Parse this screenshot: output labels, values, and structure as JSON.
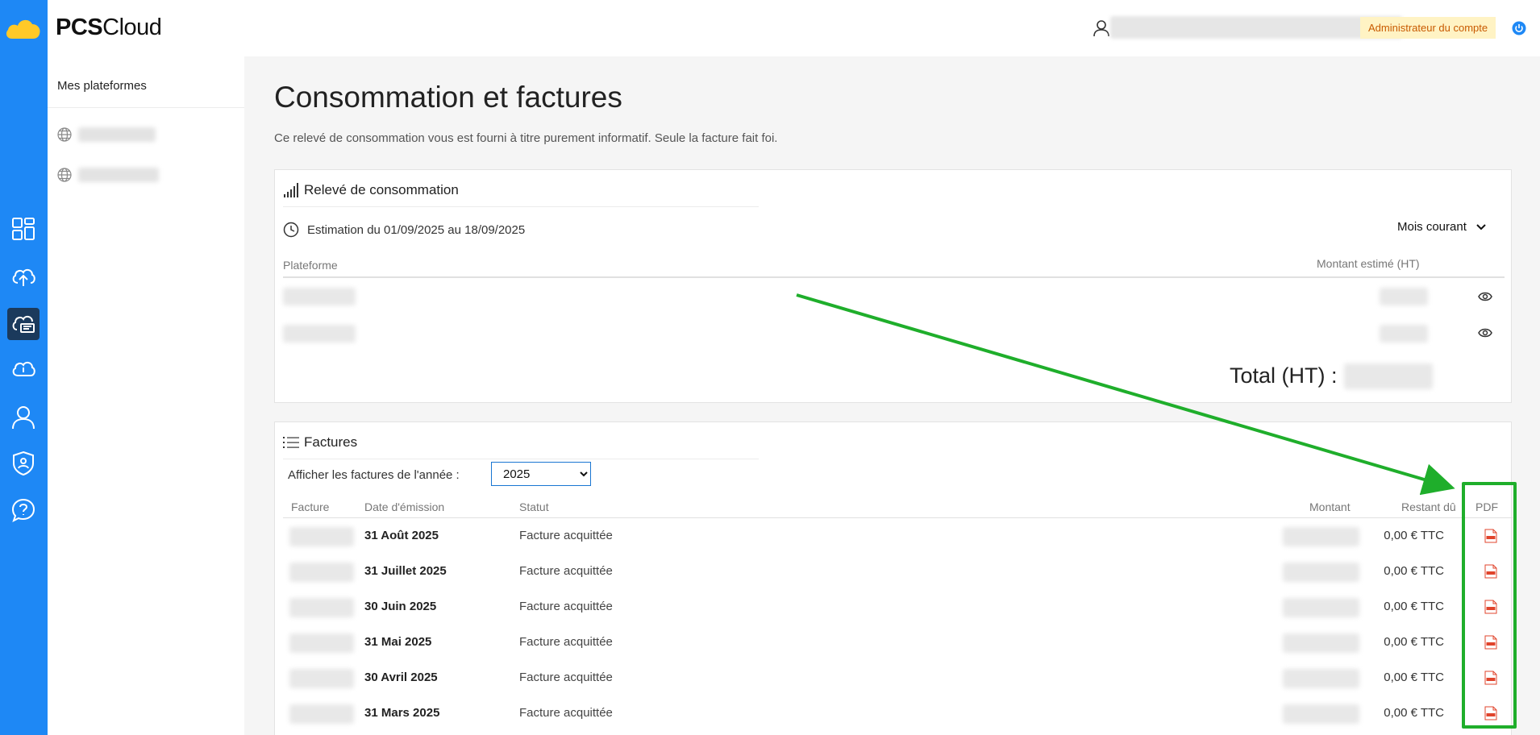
{
  "header": {
    "brand_bold": "PCS",
    "brand_light": "Cloud",
    "role": "Administrateur du compte"
  },
  "sidebar": {
    "title": "Mes plateformes"
  },
  "nav": {
    "icons": [
      "dashboard-icon",
      "cloud-upload-icon",
      "hosting-icon",
      "cloud-alert-icon",
      "user-icon",
      "shield-icon",
      "help-icon"
    ]
  },
  "page": {
    "title": "Consommation et factures",
    "subtitle": "Ce relevé de consommation vous est fourni à titre purement informatif. Seule la facture fait foi."
  },
  "consumption": {
    "title": "Relevé de consommation",
    "estimation": "Estimation du 01/09/2025 au 18/09/2025",
    "period": "Mois courant",
    "col_platform": "Plateforme",
    "col_amount": "Montant estimé (HT)",
    "total_label": "Total (HT) :"
  },
  "invoices": {
    "title": "Factures",
    "filter_label": "Afficher les factures de l'année :",
    "year": "2025",
    "columns": {
      "invoice": "Facture",
      "date": "Date d'émission",
      "status": "Statut",
      "amount": "Montant",
      "remaining": "Restant dû",
      "pdf": "PDF"
    },
    "rows": [
      {
        "date": "31 Août 2025",
        "status": "Facture acquittée",
        "remaining": "0,00 € TTC"
      },
      {
        "date": "31 Juillet 2025",
        "status": "Facture acquittée",
        "remaining": "0,00 € TTC"
      },
      {
        "date": "30 Juin 2025",
        "status": "Facture acquittée",
        "remaining": "0,00 € TTC"
      },
      {
        "date": "31 Mai 2025",
        "status": "Facture acquittée",
        "remaining": "0,00 € TTC"
      },
      {
        "date": "30 Avril 2025",
        "status": "Facture acquittée",
        "remaining": "0,00 € TTC"
      },
      {
        "date": "31 Mars 2025",
        "status": "Facture acquittée",
        "remaining": "0,00 € TTC"
      }
    ]
  },
  "colors": {
    "rail": "#1e88f5",
    "annotation": "#1fae2b",
    "pdf_icon": "#e0442c"
  }
}
